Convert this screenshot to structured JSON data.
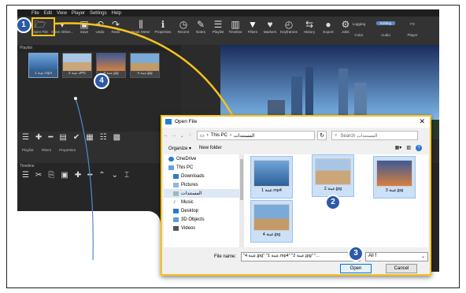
{
  "menu": [
    "File",
    "Edit",
    "View",
    "Player",
    "Settings",
    "Help"
  ],
  "toolbar": [
    {
      "label": "Open File",
      "icon": "folder-icon"
    },
    {
      "label": "Open Other...",
      "icon": "open-other-icon"
    },
    {
      "label": "Save",
      "icon": "save-icon"
    },
    {
      "label": "Undo",
      "icon": "undo-icon"
    },
    {
      "label": "Redo",
      "icon": "redo-icon"
    },
    {
      "label": "Peak Meter",
      "icon": "peak-meter-icon"
    },
    {
      "label": "Properties",
      "icon": "properties-icon"
    },
    {
      "label": "Recent",
      "icon": "recent-icon"
    },
    {
      "label": "Notes",
      "icon": "notes-icon"
    },
    {
      "label": "Playlist",
      "icon": "playlist-icon"
    },
    {
      "label": "Timeline",
      "icon": "timeline-icon"
    },
    {
      "label": "Filters",
      "icon": "filter-icon"
    },
    {
      "label": "Markers",
      "icon": "marker-icon"
    },
    {
      "label": "Keyframes",
      "icon": "keyframes-icon"
    },
    {
      "label": "History",
      "icon": "history-icon"
    },
    {
      "label": "Export",
      "icon": "export-icon"
    },
    {
      "label": "Jobs",
      "icon": "jobs-icon"
    }
  ],
  "modes": {
    "top": [
      "Logging",
      "Editing",
      "FX"
    ],
    "bottom": [
      "Color",
      "Audio",
      "Player"
    ],
    "active": "Editing"
  },
  "playlist": {
    "title": "Playlist",
    "items": [
      "1 عينة.mp4",
      "2 عينة.JPG",
      "3 عينة.jpg",
      "4 عينة.jpg"
    ],
    "tabs": [
      "Playlist",
      "Filters",
      "Properties"
    ]
  },
  "timeline": {
    "title": "Timeline"
  },
  "badges": [
    "1",
    "2",
    "3",
    "4"
  ],
  "dialog": {
    "title": "Open File",
    "path": [
      "This PC",
      "المستندات"
    ],
    "search_placeholder": "Search المستندات",
    "organize": "Organize ▾",
    "new_folder": "New folder",
    "nav": [
      "OneDrive",
      "This PC",
      "Downloads",
      "Pictures",
      "المستندات",
      "Music",
      "Desktop",
      "3D Objects",
      "Videos"
    ],
    "files": [
      "1 عينة.mp4",
      "2 عينة.jpg",
      "3 عينة.jpg",
      "4 عينة.jpg"
    ],
    "file_name_label": "File name:",
    "file_name_value": "\"4 عينة.jpg\" \"1 عينة.mp4\" \"2 عينة.jpg\" \"...",
    "file_type": "All f",
    "open": "Open",
    "cancel": "Cancel"
  },
  "colors": {
    "accent": "#f6c31c",
    "badge": "#2a5aa8",
    "mode_active": "#5b86c6"
  }
}
